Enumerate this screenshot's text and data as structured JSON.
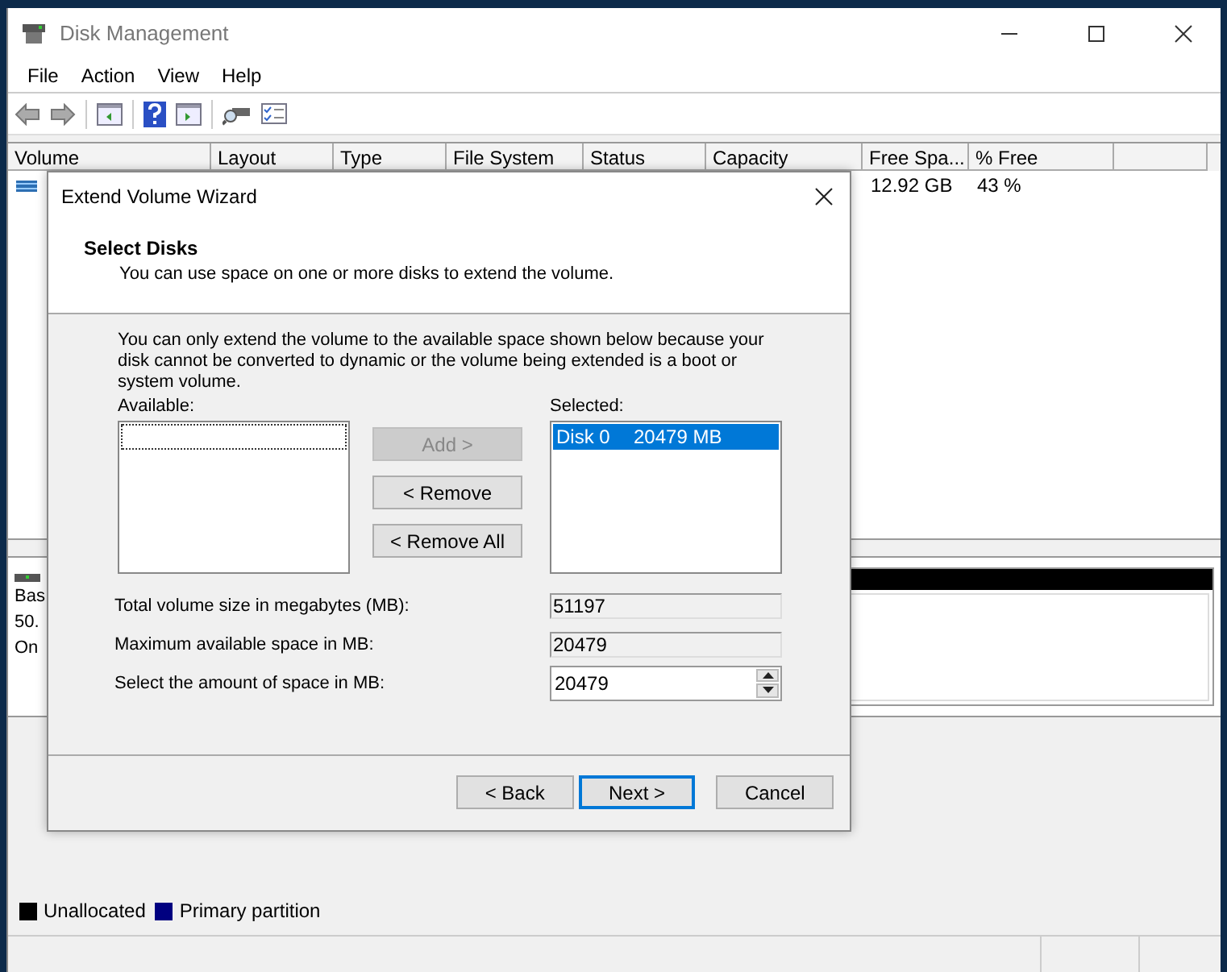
{
  "window": {
    "title": "Disk Management"
  },
  "menu": [
    "File",
    "Action",
    "View",
    "Help"
  ],
  "volume_list": {
    "columns": [
      "Volume",
      "Layout",
      "Type",
      "File System",
      "Status",
      "Capacity",
      "Free Spa...",
      "% Free"
    ],
    "rows": [
      {
        "free_space": "12.92 GB",
        "percent_free": "43 %"
      }
    ]
  },
  "disk_panel": {
    "label_lines": [
      "Bas",
      "50.",
      "On"
    ]
  },
  "legend": [
    {
      "label": "Unallocated",
      "color": "#000000"
    },
    {
      "label": "Primary partition",
      "color": "#000080"
    }
  ],
  "dialog": {
    "title": "Extend Volume Wizard",
    "heading": "Select Disks",
    "subheading": "You can use space on one or more disks to extend the volume.",
    "message": "You can only extend the volume to the available space shown below because your disk cannot be converted to dynamic or the volume being extended is a boot or system volume.",
    "available_label": "Available:",
    "selected_label": "Selected:",
    "selected_items": [
      {
        "disk": "Disk 0",
        "size": "20479 MB",
        "selected": true
      }
    ],
    "transfer_buttons": [
      {
        "label": "Add >",
        "disabled": true
      },
      {
        "label": "< Remove",
        "disabled": false
      },
      {
        "label": "< Remove All",
        "disabled": false
      }
    ],
    "fields": [
      {
        "label": "Total volume size in megabytes (MB):",
        "value": "51197",
        "kind": "readonly"
      },
      {
        "label": "Maximum available space in MB:",
        "value": "20479",
        "kind": "readonly"
      },
      {
        "label": "Select the amount of space in MB:",
        "value": "20479",
        "kind": "spinner"
      }
    ],
    "nav_buttons": [
      {
        "label": "< Back",
        "default": false
      },
      {
        "label": "Next >",
        "default": true
      },
      {
        "label": "Cancel",
        "default": false
      }
    ]
  }
}
